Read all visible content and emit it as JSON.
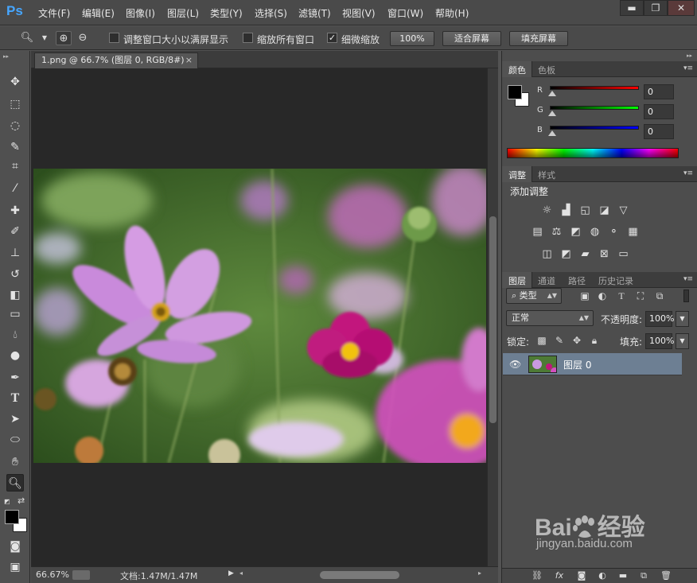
{
  "app": {
    "logo": "Ps"
  },
  "menu": [
    "文件(F)",
    "编辑(E)",
    "图像(I)",
    "图层(L)",
    "类型(Y)",
    "选择(S)",
    "滤镜(T)",
    "视图(V)",
    "窗口(W)",
    "帮助(H)"
  ],
  "window_controls": {
    "minimize": "▬",
    "restore": "❐",
    "close": "✕"
  },
  "options": {
    "resize_windows_label": "调整窗口大小以满屏显示",
    "zoom_all_label": "缩放所有窗口",
    "scrubby_zoom_label": "细微缩放",
    "scrubby_zoom_checked": "✓",
    "btn_100": "100%",
    "btn_fit": "适合屏幕",
    "btn_fill": "填充屏幕"
  },
  "document": {
    "tab_title": "1.png @ 66.7% (图层 0, RGB/8#)",
    "close": "×"
  },
  "status": {
    "zoom": "66.67%",
    "doc_size": "文档:1.47M/1.47M"
  },
  "color_panel": {
    "tabs": [
      "颜色",
      "色板"
    ],
    "channels": [
      {
        "label": "R",
        "value": "0",
        "color": "#ff0000"
      },
      {
        "label": "G",
        "value": "0",
        "color": "#00ff00"
      },
      {
        "label": "B",
        "value": "0",
        "color": "#0000ff"
      }
    ],
    "foreground": "#000000",
    "background": "#ffffff"
  },
  "adjust_panel": {
    "tabs": [
      "调整",
      "样式"
    ],
    "title": "添加调整"
  },
  "layers_panel": {
    "tabs": [
      "图层",
      "通道",
      "路径",
      "历史记录"
    ],
    "filter_label": "类型",
    "blend_mode": "正常",
    "opacity_label": "不透明度:",
    "opacity_value": "100%",
    "lock_label": "锁定:",
    "fill_label": "填充:",
    "fill_value": "100%",
    "layers": [
      {
        "name": "图层 0",
        "visible": true
      }
    ]
  },
  "watermark": {
    "brand_left": "Bai",
    "brand_right": "经验",
    "url": "jingyan.baidu.com"
  }
}
